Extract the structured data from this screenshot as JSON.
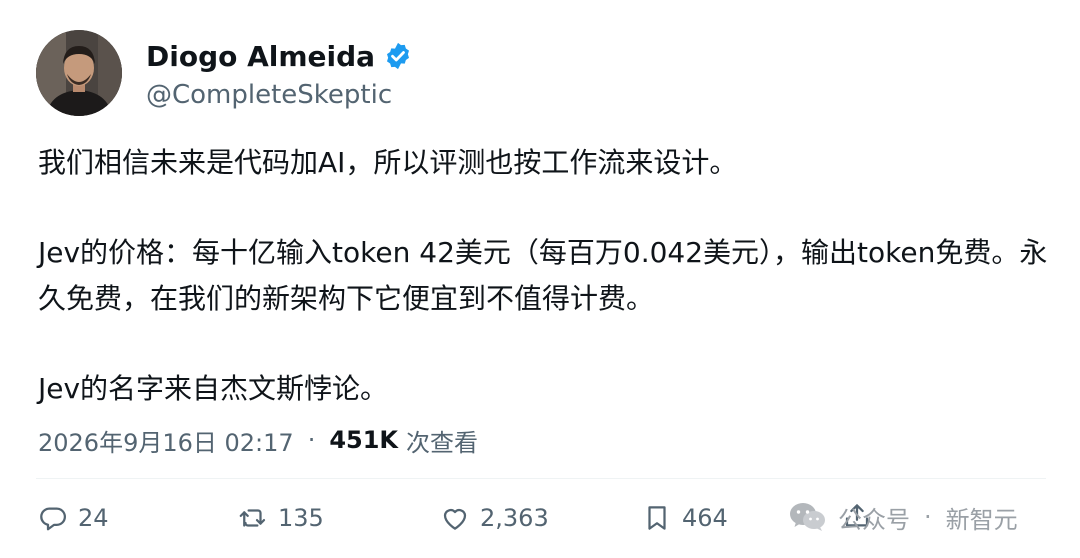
{
  "author": {
    "name": "Diogo Almeida",
    "handle": "@CompleteSkeptic"
  },
  "tweet": {
    "line1": "我们相信未来是代码加AI，所以评测也按工作流来设计。",
    "line2": "Jev的价格：每十亿输入token 42美元（每百万0.042美元），输出token免费。永久免费，在我们的新架构下它便宜到不值得计费。",
    "line3": "Jev的名字来自杰文斯悖论。"
  },
  "meta": {
    "timestamp": "2026年9月16日 02:17",
    "separator": "·",
    "views_count": "451K",
    "views_label": "次查看"
  },
  "actions": {
    "replies": "24",
    "retweets": "135",
    "likes": "2,363",
    "bookmarks": "464"
  },
  "watermark": {
    "source": "公众号",
    "separator": "·",
    "account": "新智元"
  },
  "colors": {
    "text": "#0f1419",
    "secondary": "#536471",
    "verified": "#1d9bf0",
    "watermark": "#9aa0a6"
  }
}
